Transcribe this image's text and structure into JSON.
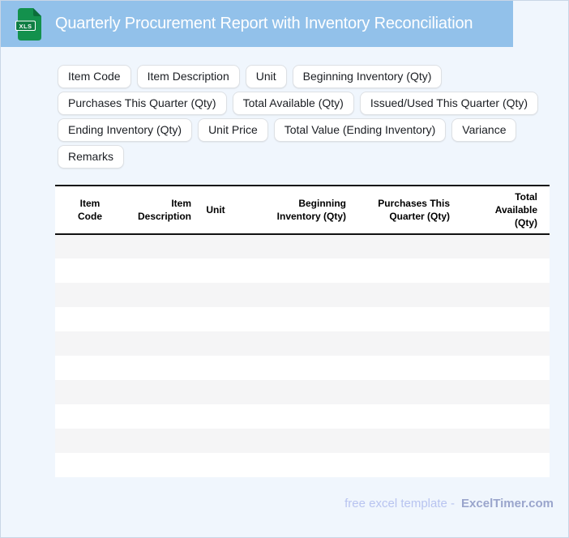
{
  "header": {
    "title": "Quarterly Procurement Report with Inventory Reconciliation",
    "file_badge": "XLS"
  },
  "chips": [
    "Item Code",
    "Item Description",
    "Unit",
    "Beginning Inventory (Qty)",
    "Purchases This Quarter (Qty)",
    "Total Available (Qty)",
    "Issued/Used This Quarter (Qty)",
    "Ending Inventory (Qty)",
    "Unit Price",
    "Total Value (Ending Inventory)",
    "Variance",
    "Remarks"
  ],
  "table": {
    "columns": [
      "Item Code",
      "Item Description",
      "Unit",
      "Beginning Inventory (Qty)",
      "Purchases This Quarter (Qty)",
      "Total Available (Qty)"
    ],
    "row_count": 10
  },
  "footer": {
    "text": "free excel template -",
    "brand": "ExcelTimer.com"
  },
  "colors": {
    "header_bg": "#92c1ea",
    "page_bg": "#f0f6fd",
    "icon_green": "#13914d",
    "icon_green_dark": "#0e7c42",
    "icon_fold_green": "#0b6d3a",
    "row_stripe": "#f5f5f6",
    "table_border": "#111111",
    "footer_text": "#b8c4f0",
    "footer_brand": "#9aa5cc"
  }
}
